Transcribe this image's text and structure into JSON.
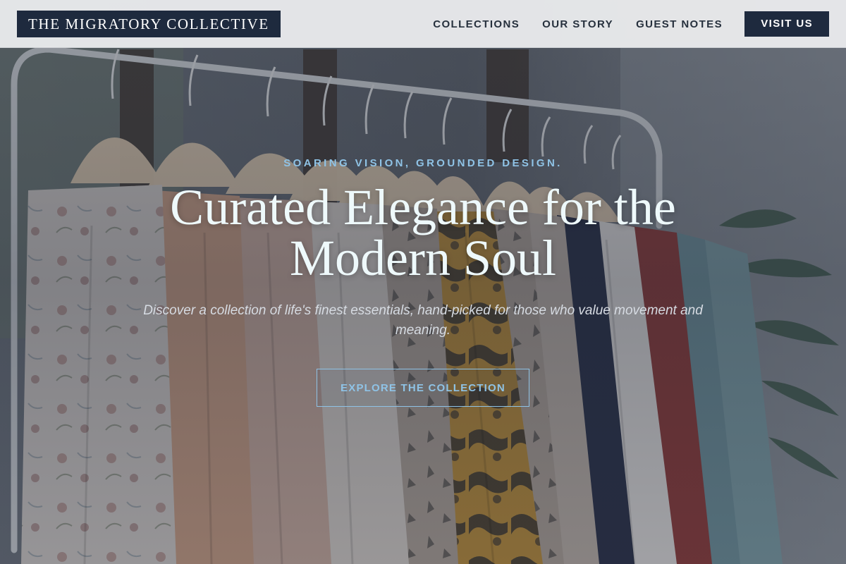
{
  "brand": {
    "name": "THE MIGRATORY COLLECTIVE"
  },
  "nav": {
    "links": [
      {
        "label": "COLLECTIONS"
      },
      {
        "label": "OUR STORY"
      },
      {
        "label": "GUEST NOTES"
      }
    ],
    "cta_label": "VISIT US"
  },
  "hero": {
    "eyebrow": "SOARING VISION, GROUNDED DESIGN.",
    "headline": "Curated Elegance for the Modern Soul",
    "subheadline": "Discover a collection of life's finest essentials, hand-picked for those who value movement and meaning.",
    "cta_label": "EXPLORE THE COLLECTION",
    "background_image": "clothing-rack-photo"
  },
  "colors": {
    "brand_navy": "#1e2a3e",
    "accent_sky": "#8fc3e6",
    "header_bg": "#e8e9eb",
    "headline_text": "#eef9fb"
  }
}
